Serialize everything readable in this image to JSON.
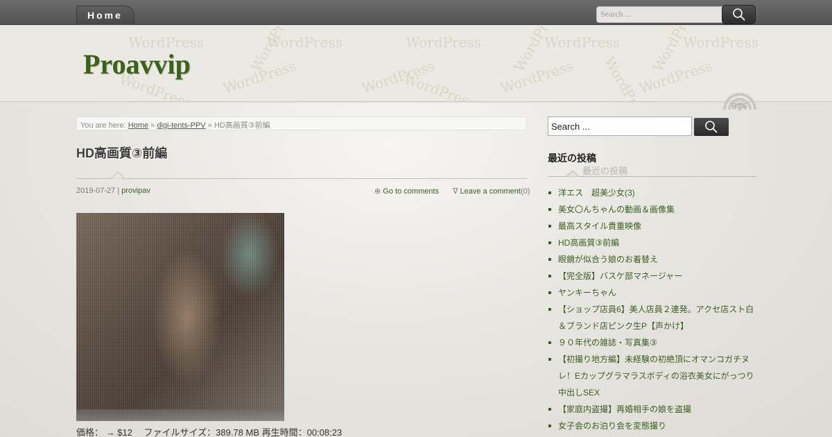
{
  "nav": {
    "home_label": "Home",
    "search_placeholder": "Search ..."
  },
  "header": {
    "site_title": "Proavvip",
    "watermark_text": "WordPress",
    "rss_label": "RSS"
  },
  "breadcrumb": {
    "prefix": "You are here:",
    "home": "Home",
    "sep1": "»",
    "category": "digi-tents-PPV",
    "sep2": "»",
    "current": "HD高画質③前編"
  },
  "post": {
    "title": "HD高画質③前編",
    "date": "2019-07-27",
    "separator": "|",
    "author": "provipav",
    "comments_icon": "⊕",
    "go_to_comments": "Go to comments",
    "leave_icon": "∇",
    "leave_comment": "Leave a comment",
    "comment_count": "(0)",
    "info_line": "価格： → $12　 ファイルサイズ：389.78 MB 再生時間：00:08:23"
  },
  "sidebar": {
    "search_value": "Search ...",
    "widget_title": "最近の投稿",
    "widget_title_shadow": "最近の投稿",
    "recent_posts": [
      "洋エス　超美少女(3)",
      "美女〇んちゃんの動画＆画像集",
      "最高スタイル貴重映像",
      "HD高画質③前編",
      "眼鏡が似合う娘のお着替え",
      "【完全版】バスケ部マネージャー",
      "ヤンキーちゃん",
      "【ショップ店員6】美人店員２連発。アクセ店スト白＆ブランド店ピンク生P【声かけ】",
      "９０年代の雑誌・写真集③",
      "【初撮り地方編】未経験の初絶頂にオマンコガチヌレ！Eカップグラマラスボディの浴衣美女にがっつり中出しSEX",
      "【家庭内盗撮】再婚相手の娘を盗撮",
      "女子会のお泊り会を変態撮り"
    ]
  },
  "colors": {
    "accent_green": "#3a5e1f",
    "title_green": "#3b6219",
    "topbar": "#5e5e5e"
  }
}
